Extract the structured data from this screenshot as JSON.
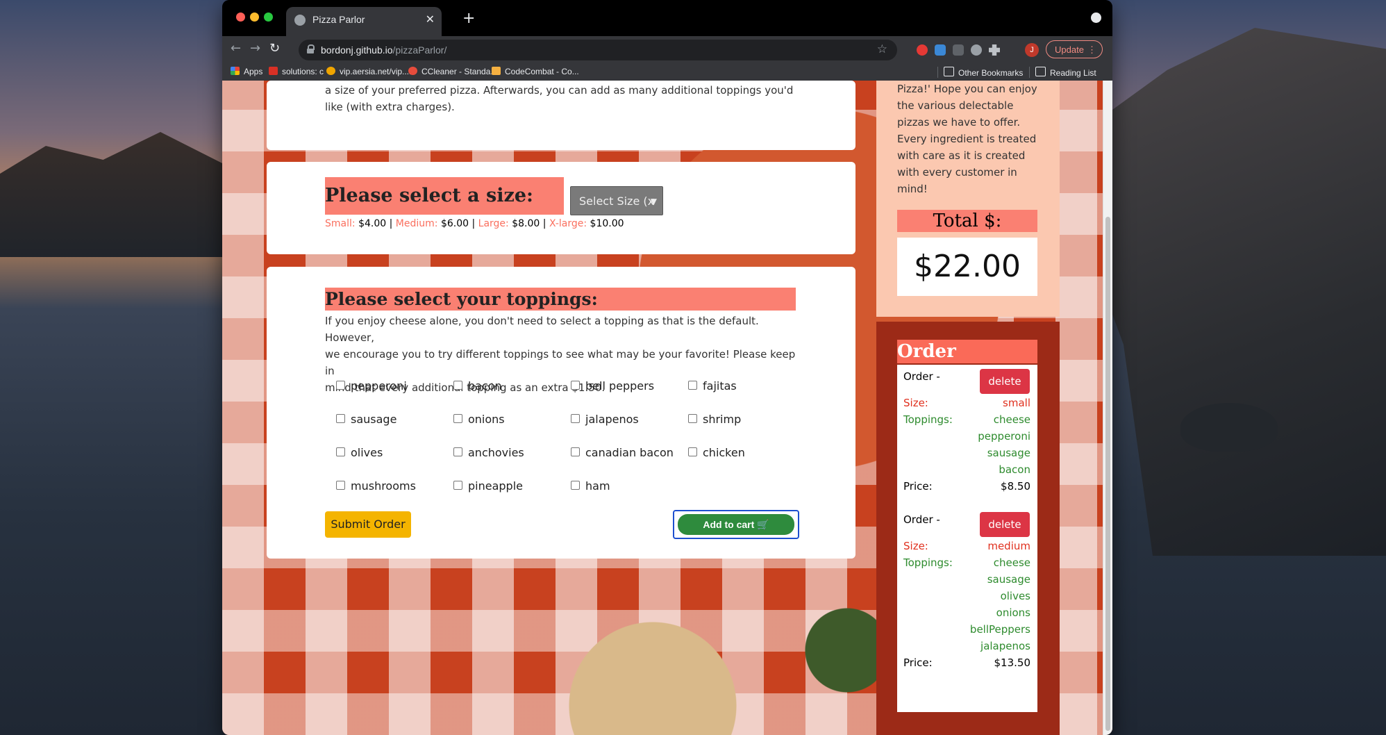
{
  "browser": {
    "tab_title": "Pizza Parlor",
    "url_host": "bordonj.github.io",
    "url_path": "/pizzaParlor/",
    "avatar_letter": "J",
    "update_label": "Update",
    "bookmarks": [
      "Apps",
      "solutions: c",
      "vip.aersia.net/vip....",
      "CCleaner - Standa...",
      "CodeCombat - Co..."
    ],
    "other_bookmarks": "Other Bookmarks",
    "reading_list": "Reading List"
  },
  "intro": {
    "line_a": "a size of your preferred pizza. Afterwards, you can add as many additional toppings you'd",
    "line_b": "like (with extra charges)."
  },
  "size_section": {
    "heading": "Please select a size:",
    "select_value": "Select Size (x",
    "prices": [
      {
        "label": "Small:",
        "price": "$4.00"
      },
      {
        "label": "Medium:",
        "price": "$6.00"
      },
      {
        "label": "Large:",
        "price": "$8.00"
      },
      {
        "label": "X-large:",
        "price": "$10.00"
      }
    ],
    "separator": "|"
  },
  "toppings_section": {
    "heading": "Please select your toppings:",
    "line1": "If you enjoy cheese alone, you don't need to select a topping as that is the default. However,",
    "line2": "we encourage you to try different toppings to see what may be your favorite! Please keep in",
    "line3": "mind that every additional topping as an extra $1.50.",
    "items": [
      "pepperoni",
      "bacon",
      "bell peppers",
      "fajitas",
      "sausage",
      "onions",
      "jalapenos",
      "shrimp",
      "olives",
      "anchovies",
      "canadian bacon",
      "chicken",
      "mushrooms",
      "pineapple",
      "ham"
    ],
    "submit_label": "Submit Order",
    "cart_label": "Add to cart"
  },
  "sidebar": {
    "welcome_lines": [
      "Pizza!' Hope you can enjoy",
      "the various delectable",
      "pizzas we have to offer.",
      "Every ingredient is treated",
      "with care as it is created",
      "with every customer in",
      "mind!"
    ],
    "total_label": "Total $:",
    "total_value": "$22.00",
    "order_preview_title": "Order Preview",
    "orders": [
      {
        "title": "Order -",
        "delete_label": "delete",
        "size_label": "Size:",
        "size": "small",
        "toppings_label": "Toppings:",
        "toppings": [
          "cheese",
          "pepperoni",
          "sausage",
          "bacon"
        ],
        "price_label": "Price:",
        "price": "$8.50"
      },
      {
        "title": "Order -",
        "delete_label": "delete",
        "size_label": "Size:",
        "size": "medium",
        "toppings_label": "Toppings:",
        "toppings": [
          "cheese",
          "sausage",
          "olives",
          "onions",
          "bellPeppers",
          "jalapenos"
        ],
        "price_label": "Price:",
        "price": "$13.50"
      }
    ]
  },
  "colors": {
    "salmon": "#fa8072",
    "sidebar_bg": "#fbc8b0",
    "order_panel_bg": "#9c2a17",
    "submit_btn": "#f4b400",
    "cart_btn": "#2e8b3d",
    "delete_btn": "#dc3545"
  }
}
